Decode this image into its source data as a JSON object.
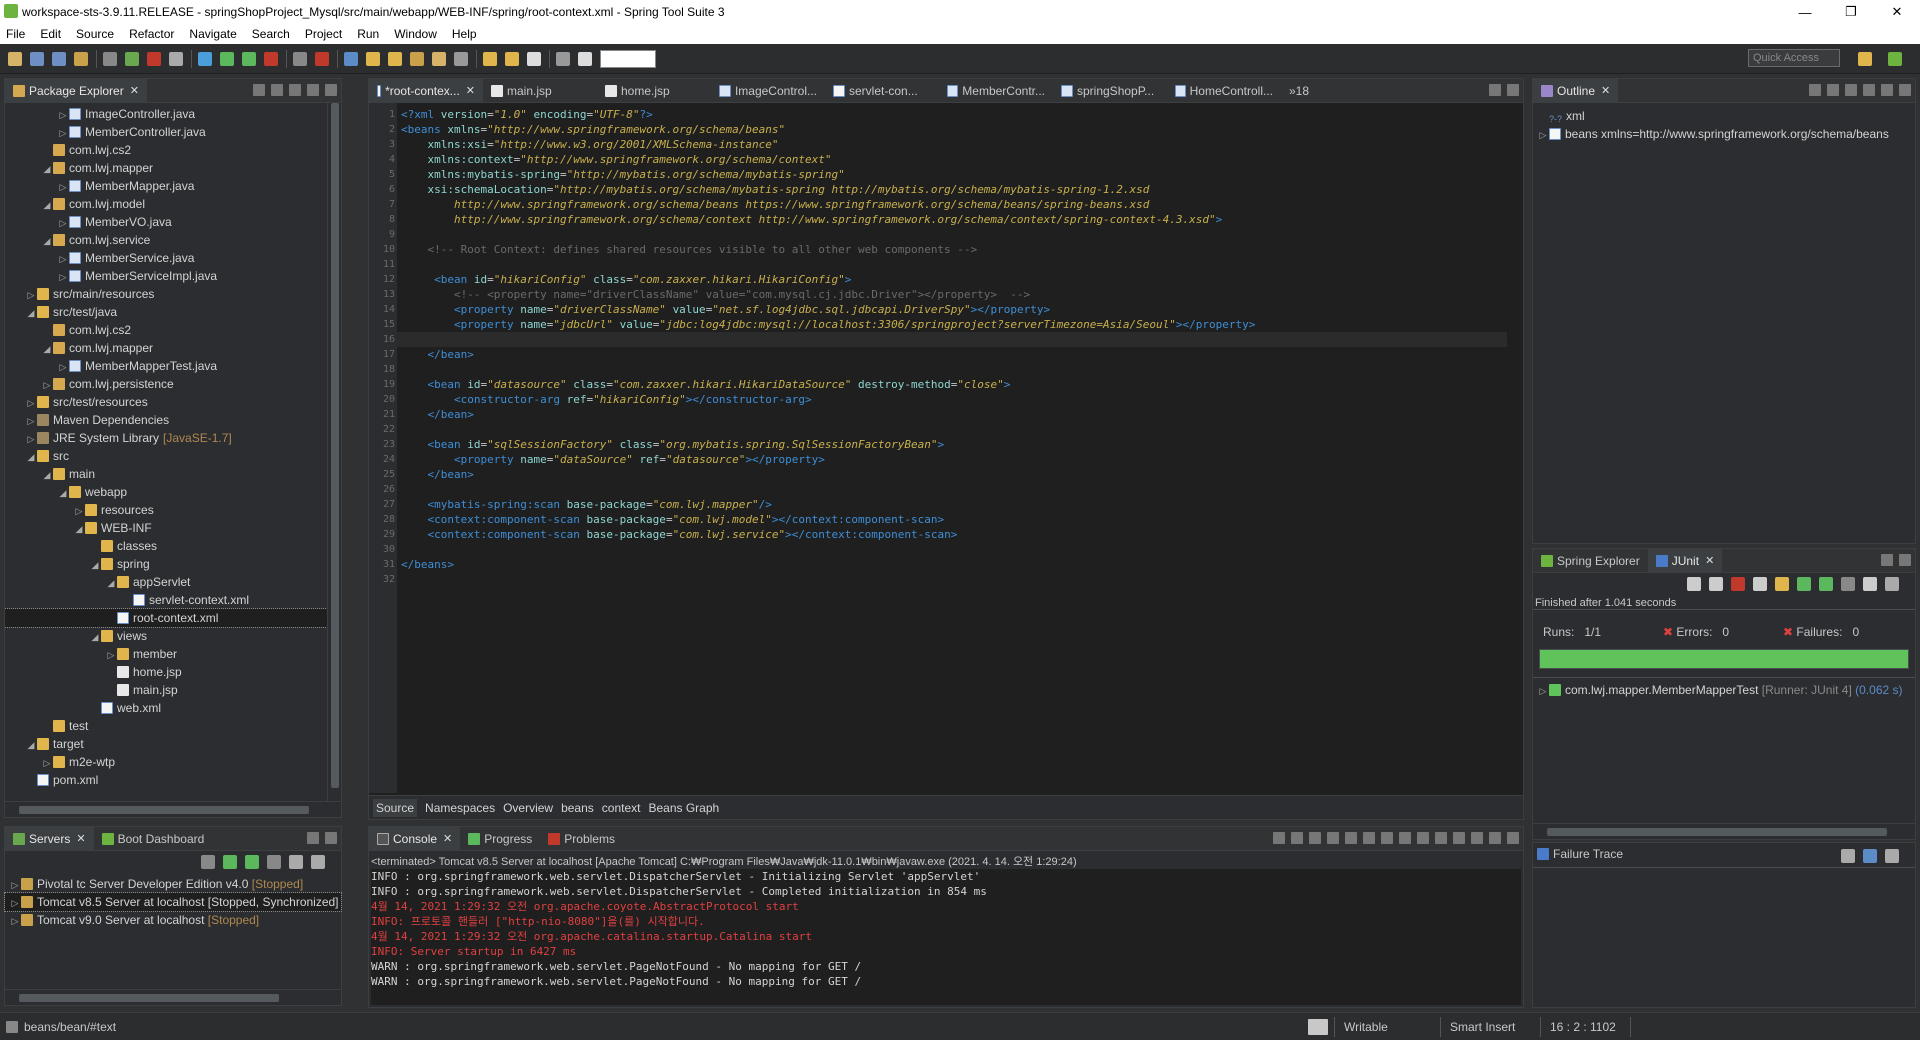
{
  "window": {
    "title": "workspace-sts-3.9.11.RELEASE - springShopProject_Mysql/src/main/webapp/WEB-INF/spring/root-context.xml - Spring Tool Suite 3",
    "minimize": "—",
    "maximize": "❐",
    "close": "✕"
  },
  "menu": [
    "File",
    "Edit",
    "Source",
    "Refactor",
    "Navigate",
    "Search",
    "Project",
    "Run",
    "Window",
    "Help"
  ],
  "toolbar": {
    "quick_access": "Quick Access"
  },
  "explorer": {
    "title": "Package Explorer",
    "rows": [
      {
        "indent": 3,
        "arrow": "▷",
        "icon": "java",
        "label": "ImageController.java"
      },
      {
        "indent": 3,
        "arrow": "▷",
        "icon": "java",
        "label": "MemberController.java"
      },
      {
        "indent": 2,
        "arrow": "",
        "icon": "pkg",
        "label": "com.lwj.cs2"
      },
      {
        "indent": 2,
        "arrow": "◢",
        "icon": "pkg",
        "label": "com.lwj.mapper"
      },
      {
        "indent": 3,
        "arrow": "▷",
        "icon": "java",
        "label": "MemberMapper.java"
      },
      {
        "indent": 2,
        "arrow": "◢",
        "icon": "pkg",
        "label": "com.lwj.model"
      },
      {
        "indent": 3,
        "arrow": "▷",
        "icon": "java",
        "label": "MemberVO.java"
      },
      {
        "indent": 2,
        "arrow": "◢",
        "icon": "pkg",
        "label": "com.lwj.service"
      },
      {
        "indent": 3,
        "arrow": "▷",
        "icon": "java",
        "label": "MemberService.java"
      },
      {
        "indent": 3,
        "arrow": "▷",
        "icon": "java",
        "label": "MemberServiceImpl.java"
      },
      {
        "indent": 1,
        "arrow": "▷",
        "icon": "fold",
        "label": "src/main/resources"
      },
      {
        "indent": 1,
        "arrow": "◢",
        "icon": "fold",
        "label": "src/test/java"
      },
      {
        "indent": 2,
        "arrow": "",
        "icon": "pkg",
        "label": "com.lwj.cs2"
      },
      {
        "indent": 2,
        "arrow": "◢",
        "icon": "pkg",
        "label": "com.lwj.mapper"
      },
      {
        "indent": 3,
        "arrow": "▷",
        "icon": "java",
        "label": "MemberMapperTest.java"
      },
      {
        "indent": 2,
        "arrow": "▷",
        "icon": "pkg",
        "label": "com.lwj.persistence"
      },
      {
        "indent": 1,
        "arrow": "▷",
        "icon": "fold",
        "label": "src/test/resources"
      },
      {
        "indent": 1,
        "arrow": "▷",
        "icon": "lib",
        "label": "Maven Dependencies"
      },
      {
        "indent": 1,
        "arrow": "▷",
        "icon": "lib",
        "label": "JRE System Library",
        "extra": "[JavaSE-1.7]"
      },
      {
        "indent": 1,
        "arrow": "◢",
        "icon": "fold",
        "label": "src"
      },
      {
        "indent": 2,
        "arrow": "◢",
        "icon": "fold",
        "label": "main"
      },
      {
        "indent": 3,
        "arrow": "◢",
        "icon": "fold",
        "label": "webapp"
      },
      {
        "indent": 4,
        "arrow": "▷",
        "icon": "fold",
        "label": "resources"
      },
      {
        "indent": 4,
        "arrow": "◢",
        "icon": "fold",
        "label": "WEB-INF"
      },
      {
        "indent": 5,
        "arrow": "",
        "icon": "fold",
        "label": "classes"
      },
      {
        "indent": 5,
        "arrow": "◢",
        "icon": "fold",
        "label": "spring"
      },
      {
        "indent": 6,
        "arrow": "◢",
        "icon": "fold",
        "label": "appServlet"
      },
      {
        "indent": 7,
        "arrow": "",
        "icon": "xml",
        "label": "servlet-context.xml"
      },
      {
        "indent": 6,
        "arrow": "",
        "icon": "xml",
        "label": "root-context.xml",
        "selected": true
      },
      {
        "indent": 5,
        "arrow": "◢",
        "icon": "fold",
        "label": "views"
      },
      {
        "indent": 6,
        "arrow": "▷",
        "icon": "fold",
        "label": "member"
      },
      {
        "indent": 6,
        "arrow": "",
        "icon": "file",
        "label": "home.jsp"
      },
      {
        "indent": 6,
        "arrow": "",
        "icon": "file",
        "label": "main.jsp"
      },
      {
        "indent": 5,
        "arrow": "",
        "icon": "xml",
        "label": "web.xml"
      },
      {
        "indent": 2,
        "arrow": "",
        "icon": "fold",
        "label": "test"
      },
      {
        "indent": 1,
        "arrow": "◢",
        "icon": "fold",
        "label": "target"
      },
      {
        "indent": 2,
        "arrow": "▷",
        "icon": "fold",
        "label": "m2e-wtp"
      },
      {
        "indent": 1,
        "arrow": "",
        "icon": "xml",
        "label": "pom.xml"
      }
    ]
  },
  "servers": {
    "tabs": [
      "Servers",
      "Boot Dashboard"
    ],
    "rows": [
      {
        "label": "Pivotal tc Server Developer Edition v4.0",
        "state": "[Stopped]"
      },
      {
        "label": "Tomcat v8.5 Server at localhost",
        "state": "[Stopped, Synchronized]",
        "selected": true
      },
      {
        "label": "Tomcat v9.0 Server at localhost",
        "state": "[Stopped]"
      }
    ]
  },
  "editor": {
    "tabs": [
      "*root-contex...",
      "main.jsp",
      "home.jsp",
      "ImageControl...",
      "servlet-con...",
      "MemberContr...",
      "springShopP...",
      "HomeControll..."
    ],
    "overflow": "»18",
    "bottom_tabs": [
      "Source",
      "Namespaces",
      "Overview",
      "beans",
      "context",
      "Beans Graph"
    ],
    "lines": [
      {
        "n": "1",
        "h": "<span class='c-tag'>&lt;?xml</span> <span class='c-att'>version</span>=<span class='c-val'>\"1.0\"</span> <span class='c-att'>encoding</span>=<span class='c-val'>\"UTF-8\"</span><span class='c-tag'>?&gt;</span>"
      },
      {
        "n": "2",
        "h": "<span class='c-tag'>&lt;beans</span> <span class='c-att'>xmlns</span>=<span class='c-val'>\"http://www.springframework.org/schema/beans\"</span>"
      },
      {
        "n": "3",
        "h": "    <span class='c-att'>xmlns:xsi</span>=<span class='c-val'>\"http://www.w3.org/2001/XMLSchema-instance\"</span>"
      },
      {
        "n": "4",
        "h": "    <span class='c-att'>xmlns:context</span>=<span class='c-val'>\"http://www.springframework.org/schema/context\"</span>"
      },
      {
        "n": "5",
        "h": "    <span class='c-att'>xmlns:mybatis-spring</span>=<span class='c-val'>\"http://mybatis.org/schema/mybatis-spring\"</span>"
      },
      {
        "n": "6",
        "h": "    <span class='c-att'>xsi:schemaLocation</span>=<span class='c-val'>\"http://mybatis.org/schema/mybatis-spring http://mybatis.org/schema/mybatis-spring-1.2.xsd</span>"
      },
      {
        "n": "7",
        "h": "        <span class='c-val'>http://www.springframework.org/schema/beans https://www.springframework.org/schema/beans/spring-beans.xsd</span>"
      },
      {
        "n": "8",
        "h": "        <span class='c-val'>http://www.springframework.org/schema/context http://www.springframework.org/schema/context/spring-context-4.3.xsd\"</span><span class='c-tag'>&gt;</span>"
      },
      {
        "n": "9",
        "h": ""
      },
      {
        "n": "10",
        "h": "    <span class='c-cmt'>&lt;!-- Root Context: defines shared resources visible to all other web components --&gt;</span>"
      },
      {
        "n": "11",
        "h": ""
      },
      {
        "n": "12",
        "h": "     <span class='c-tag'>&lt;bean</span> <span class='c-att'>id</span>=<span class='c-val'>\"hikariConfig\"</span> <span class='c-att'>class</span>=<span class='c-val'>\"com.zaxxer.hikari.HikariConfig\"</span><span class='c-tag'>&gt;</span>"
      },
      {
        "n": "13",
        "h": "        <span class='c-cmt'>&lt;!-- &lt;property name=\"driverClassName\" value=\"com.mysql.cj.jdbc.Driver\"&gt;&lt;/property&gt;  --&gt;</span>"
      },
      {
        "n": "14",
        "h": "        <span class='c-tag'>&lt;property</span> <span class='c-att'>name</span>=<span class='c-val'>\"driverClassName\"</span> <span class='c-att'>value</span>=<span class='c-val'>\"net.sf.log4jdbc.sql.jdbcapi.DriverSpy\"</span><span class='c-tag'>&gt;&lt;/property&gt;</span>"
      },
      {
        "n": "15",
        "h": "        <span class='c-tag'>&lt;property</span> <span class='c-att'>name</span>=<span class='c-val'>\"jdbcUrl\"</span> <span class='c-att'>value</span>=<span class='c-val'>\"jdbc:log4jdbc:mysql://localhost:3306/springproject?serverTimezone=Asia/Seoul\"</span><span class='c-tag'>&gt;&lt;/property&gt;</span>"
      },
      {
        "n": "16",
        "h": "",
        "cur": true
      },
      {
        "n": "17",
        "h": "    <span class='c-tag'>&lt;/bean&gt;</span>"
      },
      {
        "n": "18",
        "h": ""
      },
      {
        "n": "19",
        "h": "    <span class='c-tag'>&lt;bean</span> <span class='c-att'>id</span>=<span class='c-val'>\"datasource\"</span> <span class='c-att'>class</span>=<span class='c-val'>\"com.zaxxer.hikari.HikariDataSource\"</span> <span class='c-att'>destroy-method</span>=<span class='c-val'>\"close\"</span><span class='c-tag'>&gt;</span>"
      },
      {
        "n": "20",
        "h": "        <span class='c-tag'>&lt;constructor-arg</span> <span class='c-att'>ref</span>=<span class='c-val'>\"hikariConfig\"</span><span class='c-tag'>&gt;&lt;/constructor-arg&gt;</span>"
      },
      {
        "n": "21",
        "h": "    <span class='c-tag'>&lt;/bean&gt;</span>"
      },
      {
        "n": "22",
        "h": ""
      },
      {
        "n": "23",
        "h": "    <span class='c-tag'>&lt;bean</span> <span class='c-att'>id</span>=<span class='c-val'>\"sqlSessionFactory\"</span> <span class='c-att'>class</span>=<span class='c-val'>\"org.mybatis.spring.SqlSessionFactoryBean\"</span><span class='c-tag'>&gt;</span>"
      },
      {
        "n": "24",
        "h": "        <span class='c-tag'>&lt;property</span> <span class='c-att'>name</span>=<span class='c-val'>\"dataSource\"</span> <span class='c-att'>ref</span>=<span class='c-val'>\"datasource\"</span><span class='c-tag'>&gt;&lt;/property&gt;</span>"
      },
      {
        "n": "25",
        "h": "    <span class='c-tag'>&lt;/bean&gt;</span>"
      },
      {
        "n": "26",
        "h": ""
      },
      {
        "n": "27",
        "h": "    <span class='c-tag'>&lt;mybatis-spring:scan</span> <span class='c-att'>base-package</span>=<span class='c-val'>\"com.lwj.mapper\"</span><span class='c-tag'>/&gt;</span>"
      },
      {
        "n": "28",
        "h": "    <span class='c-tag'>&lt;context:component-scan</span> <span class='c-att'>base-package</span>=<span class='c-val'>\"com.lwj.model\"</span><span class='c-tag'>&gt;&lt;/context:component-scan&gt;</span>"
      },
      {
        "n": "29",
        "h": "    <span class='c-tag'>&lt;context:component-scan</span> <span class='c-att'>base-package</span>=<span class='c-val'>\"com.lwj.service\"</span><span class='c-tag'>&gt;&lt;/context:component-scan&gt;</span>"
      },
      {
        "n": "30",
        "h": ""
      },
      {
        "n": "31",
        "h": "<span class='c-tag'>&lt;/beans&gt;</span>"
      },
      {
        "n": "32",
        "h": ""
      }
    ]
  },
  "outline": {
    "title": "Outline",
    "rows": [
      {
        "label": "xml",
        "prefix": "?-?"
      },
      {
        "label": "beans xmlns=http://www.springframework.org/schema/beans"
      }
    ]
  },
  "junit": {
    "tabs": [
      "Spring Explorer",
      "JUnit"
    ],
    "finished": "Finished after 1.041 seconds",
    "runs_label": "Runs:",
    "runs": "1/1",
    "errors_label": "Errors:",
    "errors": "0",
    "failures_label": "Failures:",
    "failures": "0",
    "progress": 1.0,
    "test": "com.lwj.mapper.MemberMapperTest",
    "runner": "[Runner: JUnit 4]",
    "time": "(0.062 s)",
    "failure_trace": "Failure Trace"
  },
  "console": {
    "tabs": [
      "Console",
      "Progress",
      "Problems"
    ],
    "header": "<terminated> Tomcat v8.5 Server at localhost [Apache Tomcat] C:₩Program Files₩Java₩jdk-11.0.1₩bin₩javaw.exe (2021. 4. 14. 오전 1:29:24)",
    "lines": [
      {
        "t": "INFO : org.springframework.web.servlet.DispatcherServlet - Initializing Servlet 'appServlet'",
        "red": false
      },
      {
        "t": "INFO : org.springframework.web.servlet.DispatcherServlet - Completed initialization in 854 ms",
        "red": false
      },
      {
        "t": "4월 14, 2021 1:29:32 오전 org.apache.coyote.AbstractProtocol start",
        "red": true
      },
      {
        "t": "INFO: 프로토콜 핸들러 [\"http-nio-8080\"]을(를) 시작합니다.",
        "red": true
      },
      {
        "t": "4월 14, 2021 1:29:32 오전 org.apache.catalina.startup.Catalina start",
        "red": true
      },
      {
        "t": "INFO: Server startup in 6427 ms",
        "red": true
      },
      {
        "t": "WARN : org.springframework.web.servlet.PageNotFound - No mapping for GET /",
        "red": false
      },
      {
        "t": "WARN : org.springframework.web.servlet.PageNotFound - No mapping for GET /",
        "red": false
      }
    ]
  },
  "status": {
    "path": "beans/bean/#text",
    "writable": "Writable",
    "insert": "Smart Insert",
    "pos": "16 : 2 : 1102"
  }
}
